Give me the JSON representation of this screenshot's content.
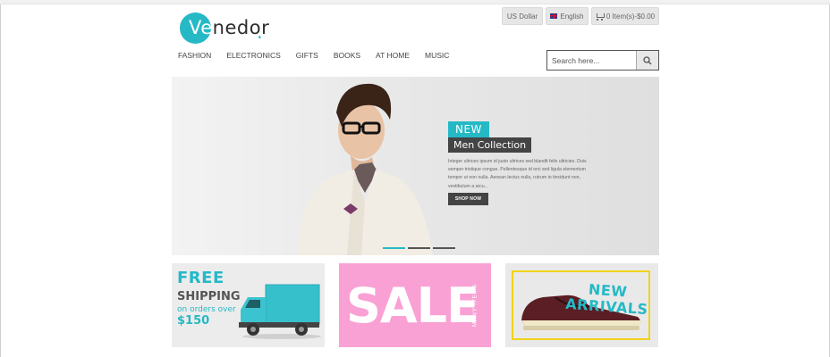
{
  "brand": {
    "logo_text_highlight": "Ve",
    "logo_text_rest": "nedor",
    "logo_dot": ".",
    "accent_color": "#25b9c6"
  },
  "header": {
    "currency_label": "US Dollar",
    "language_label": "English",
    "cart_label": "0 Item(s)-$0.00",
    "icons": [
      "flag-icon",
      "cart-icon",
      "search-icon"
    ]
  },
  "nav": {
    "items": [
      "FASHION",
      "ELECTRONICS",
      "GIFTS",
      "BOOKS",
      "AT HOME",
      "MUSIC"
    ]
  },
  "search": {
    "placeholder": "Search here..."
  },
  "hero": {
    "badge": "NEW",
    "title": "Men Collection",
    "description": "Integer ultrices ipsum id justo ultrices sed blandit felis ultricies. Duis semper tristique congue. Pellentesque id orci sed ligula elementum tempor ut non nulla. Aenean lectus nulla, rutrum in tincidunt non, vestibulum a arcu...",
    "button_label": "SHOP NOW",
    "slides_total": 3,
    "active_slide": 1
  },
  "promos": {
    "shipping": {
      "free": "FREE",
      "shipping": "SHIPPING",
      "orders": "on orders over",
      "price": "$150"
    },
    "sale": {
      "sale": "SALE",
      "many_items": "MANY ITEMS"
    },
    "arrivals": {
      "line1": "NEW",
      "line2": "ARRIVALS"
    }
  }
}
